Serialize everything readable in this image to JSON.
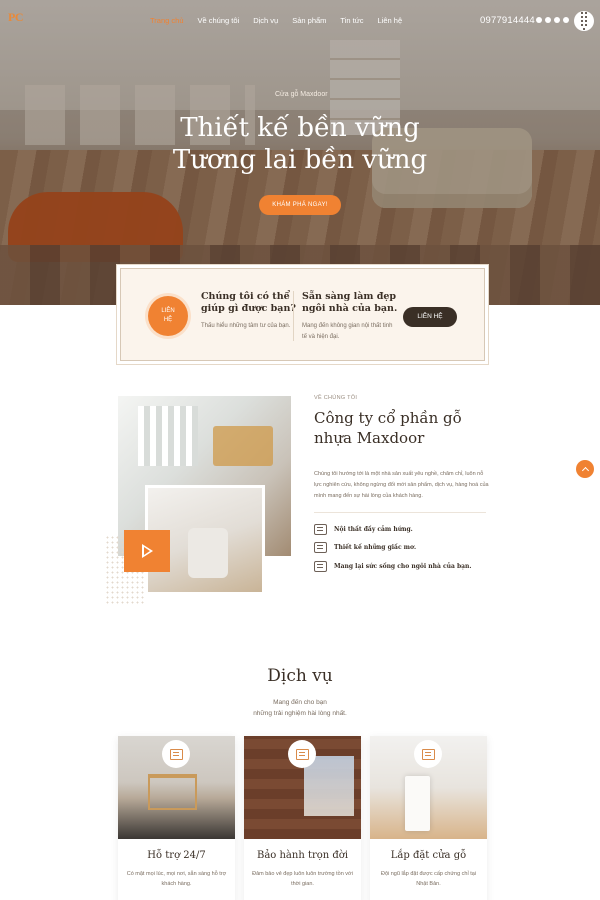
{
  "nav": {
    "logo": "PC",
    "logo_suffix": "",
    "items": [
      "Trang chủ",
      "Về chúng tôi",
      "Dịch vụ",
      "Sản phẩm",
      "Tin tức",
      "Liên hệ"
    ],
    "phone": "0977914444",
    "social_icons": [
      "facebook-icon",
      "youtube-icon",
      "pinterest-icon",
      "google-icon"
    ],
    "accent_color": "#f08232"
  },
  "hero": {
    "eyebrow": "Cửa gỗ Maxdoor",
    "title_line1": "Thiết kế bền vững",
    "title_line2": "Tương lai bền vững",
    "cta_label": "KHÁM PHÁ NGAY!"
  },
  "contact_box": {
    "circle_label_line1": "LIÊN",
    "circle_label_line2": "HỆ",
    "left_title": "Chúng tôi có thể giúp gì được bạn?",
    "left_text": "Thấu hiểu những tâm tư của bạn.",
    "right_title": "Sẵn sàng làm đẹp ngôi nhà của bạn.",
    "right_text": "Mang đến không gian nội thất tinh tế và hiện đại.",
    "button_label": "LIÊN HỆ"
  },
  "about": {
    "eyebrow": "VỀ CHÚNG TÔI",
    "title": "Công ty cổ phần gỗ nhựa Maxdoor",
    "body": "Chúng tôi hướng tới là một nhà sản xuất yêu nghề, chăm chỉ, luôn nỗ lực nghiên cứu, không ngừng đổi mới sản phẩm, dịch vụ, hàng hoá của mình mang đến sự hài lòng của khách hàng.",
    "features": [
      {
        "icon": "house-icon",
        "label": "Nội thất đầy cảm hứng."
      },
      {
        "icon": "chat-icon",
        "label": "Thiết kế những giấc mơ."
      },
      {
        "icon": "building-icon",
        "label": "Mang lại sức sống cho ngôi nhà của bạn."
      }
    ]
  },
  "services": {
    "title": "Dịch vụ",
    "subtitle_line1": "Mang đến cho bạn",
    "subtitle_line2": "những trải nghiệm hài lòng nhất.",
    "cards": [
      {
        "name": "Hỗ trợ 24/7",
        "desc": "Có mặt mọi lúc, mọi nơi, sẵn sàng hỗ trợ khách hàng.",
        "icon": "support-icon"
      },
      {
        "name": "Bảo hành trọn đời",
        "desc": "Đảm bảo vẻ đẹp luôn luôn trường tồn với thời gian.",
        "icon": "warranty-icon"
      },
      {
        "name": "Lắp đặt cửa gỗ",
        "desc": "Đội ngũ lắp đặt được cấp chứng chỉ tại Nhật Bản.",
        "icon": "door-icon"
      }
    ]
  }
}
